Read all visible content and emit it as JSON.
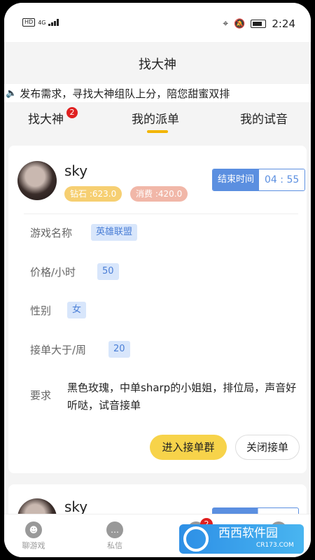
{
  "status_bar": {
    "network_label": "HD",
    "signal_label": "4G",
    "time": "2:24"
  },
  "header": {
    "title": "找大神"
  },
  "notice": {
    "text": "发布需求，寻找大神组队上分，陪您甜蜜双排"
  },
  "tabs": [
    {
      "label": "找大神",
      "badge": "2"
    },
    {
      "label": "我的派单",
      "active": true
    },
    {
      "label": "我的试音"
    }
  ],
  "order": {
    "username": "sky",
    "diamond_label": "钻石 :623.0",
    "spend_label": "消费 :420.0",
    "end_time_label": "结束时间",
    "end_time_value": "04 : 55",
    "fields": [
      {
        "label": "游戏名称",
        "value": "英雄联盟"
      },
      {
        "label": "价格/小时",
        "value": "50"
      },
      {
        "label": "性别",
        "value": "女"
      },
      {
        "label": "接单大于/周",
        "value": "20"
      }
    ],
    "requirement_label": "要求",
    "requirement_text": "黑色玫瑰，中单sharp的小姐姐，排位局，声音好听哒，试音接单",
    "join_button": "进入接单群",
    "close_button": "关闭接单"
  },
  "order2": {
    "username": "sky"
  },
  "bottom_nav": [
    {
      "label": "聊游戏",
      "icon": "people-icon"
    },
    {
      "label": "私信",
      "icon": "chat-icon"
    },
    {
      "label": "",
      "icon": "orders-icon",
      "badge": "2"
    },
    {
      "label": "",
      "icon": "profile-icon"
    }
  ],
  "watermark": {
    "title": "西西软件园",
    "subtitle": "CR173.COM"
  },
  "colors": {
    "accent": "#f2b500",
    "blue": "#5b8fe0",
    "badge": "#e02020"
  }
}
